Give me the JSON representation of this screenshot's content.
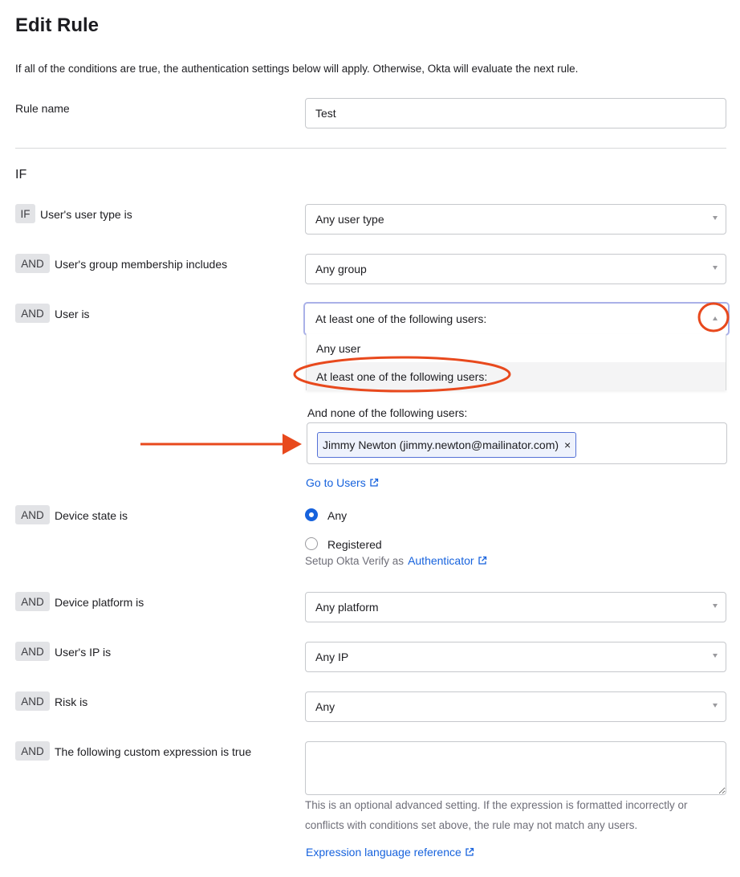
{
  "page": {
    "title": "Edit Rule",
    "description": "If all of the conditions are true, the authentication settings below will apply. Otherwise, Okta will evaluate the next rule."
  },
  "rule_name": {
    "label": "Rule name",
    "value": "Test"
  },
  "section_if": "IF",
  "conditions": {
    "user_type": {
      "badge": "IF",
      "label": "User's user type is",
      "selected": "Any user type"
    },
    "group_membership": {
      "badge": "AND",
      "label": "User's group membership includes",
      "selected": "Any group"
    },
    "user_is": {
      "badge": "AND",
      "label": "User is",
      "selected": "At least one of the following users:",
      "options": [
        "Any user",
        "At least one of the following users:"
      ],
      "exclude_label": "And none of the following users:",
      "excluded_user": "Jimmy Newton (jimmy.newton@mailinator.com)",
      "remove_symbol": "×",
      "go_to_users": "Go to Users"
    },
    "device_state": {
      "badge": "AND",
      "label": "Device state is",
      "options": [
        "Any",
        "Registered"
      ],
      "selected": "Any",
      "helper_prefix": "Setup Okta Verify as",
      "helper_link": "Authenticator"
    },
    "device_platform": {
      "badge": "AND",
      "label": "Device platform is",
      "selected": "Any platform"
    },
    "user_ip": {
      "badge": "AND",
      "label": "User's IP is",
      "selected": "Any IP"
    },
    "risk": {
      "badge": "AND",
      "label": "Risk is",
      "selected": "Any"
    },
    "custom_expression": {
      "badge": "AND",
      "label": "The following custom expression is true",
      "value": "",
      "helper_line1": "This is an optional advanced setting. If the expression is formatted incorrectly or",
      "helper_line2": "conflicts with conditions set above, the rule may not match any users.",
      "reference_link": "Expression language reference"
    }
  },
  "annotation": {
    "color": "#e8491d"
  },
  "colors": {
    "link": "#1662dd",
    "badge_bg": "#e2e3e6",
    "focus_border": "#aab1e8"
  }
}
